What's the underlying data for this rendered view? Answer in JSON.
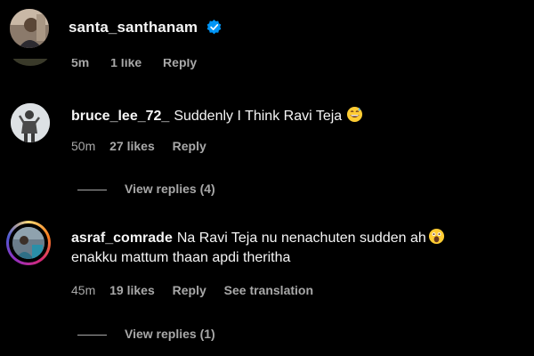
{
  "header": {
    "username": "santa_santhanam",
    "verified_icon": "verified-badge-icon"
  },
  "ghost_meta": {
    "time": "5m",
    "likes": "1 like",
    "reply": "Reply"
  },
  "comments": [
    {
      "username": "bruce_lee_72_",
      "text": "Suddenly I Think Ravi Teja",
      "emoji": "grinning-sweat-emoji",
      "time": "50m",
      "likes": "27 likes",
      "reply": "Reply",
      "view_replies": "View replies (4)"
    },
    {
      "username": "asraf_comrade",
      "text_line1": "Na Ravi Teja nu nenachuten sudden ah",
      "text_line2": "enakku mattum thaan apdi theritha",
      "emoji": "astonished-face-emoji",
      "time": "45m",
      "likes": "19 likes",
      "reply": "Reply",
      "see_translation": "See translation",
      "view_replies": "View replies (1)"
    }
  ],
  "colors": {
    "background": "#000000",
    "text": "#f5f5f5",
    "muted": "#a8a8a8",
    "verified": "#0095f6"
  }
}
